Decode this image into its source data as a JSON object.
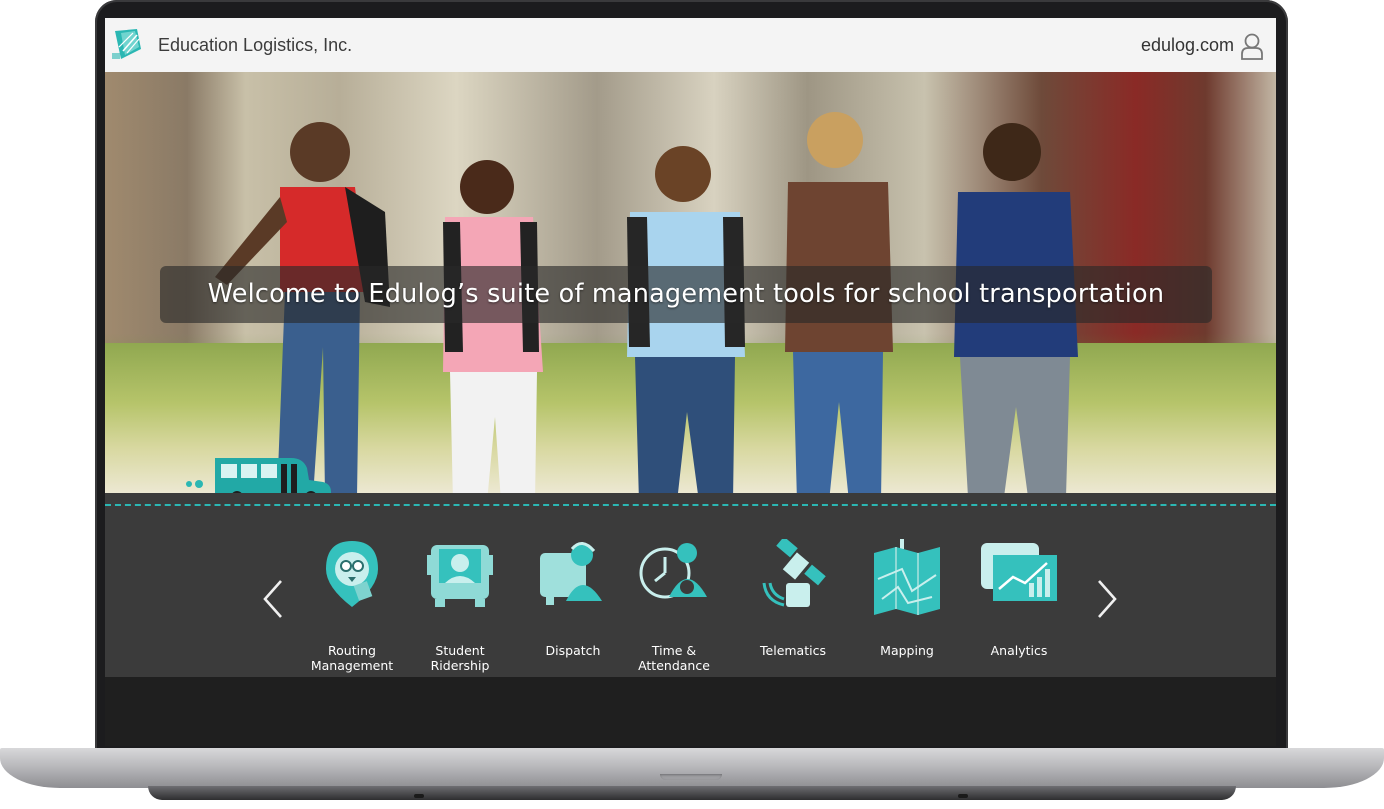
{
  "header": {
    "company": "Education Logistics, Inc.",
    "site_link": "edulog.com"
  },
  "hero": {
    "welcome": "Welcome to Edulog’s suite of management tools for school transportation"
  },
  "modules": [
    {
      "label": "Routing\nManagement",
      "icon": "routing-pin-icon"
    },
    {
      "label": "Student\nRidership",
      "icon": "student-bus-icon"
    },
    {
      "label": "Dispatch",
      "icon": "dispatch-icon"
    },
    {
      "label": "Time &\nAttendance",
      "icon": "time-attendance-icon"
    },
    {
      "label": "Telematics",
      "icon": "satellite-icon"
    },
    {
      "label": "Mapping",
      "icon": "map-icon"
    },
    {
      "label": "Analytics",
      "icon": "analytics-icon"
    }
  ],
  "colors": {
    "accent": "#2bb7b3",
    "panel": "#3b3b3b",
    "topbar": "#f4f4f4"
  }
}
